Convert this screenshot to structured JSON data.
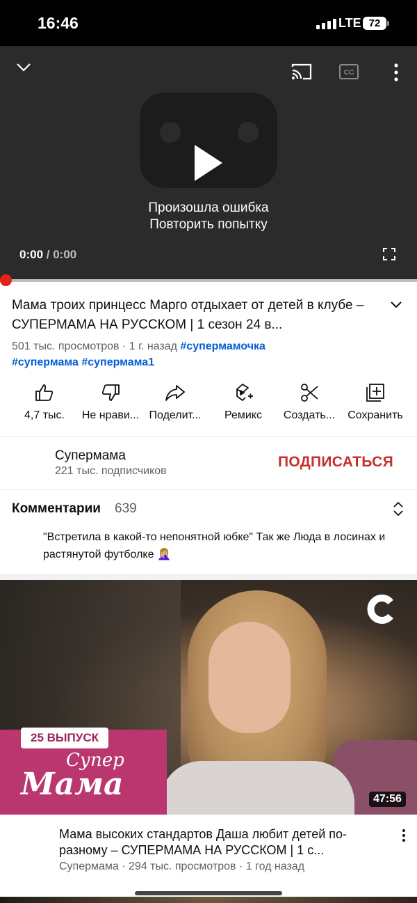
{
  "status_bar": {
    "time": "16:46",
    "network": "LTE",
    "battery": "72"
  },
  "player": {
    "error_line1": "Произошла ошибка",
    "error_line2": "Повторить попытку",
    "current_time": "0:00",
    "separator": " / ",
    "duration": "0:00",
    "progress_fraction": 0
  },
  "video": {
    "title": "Мама троих принцесс Марго отдыхает от детей в клубе – СУПЕРМАМА НА РУССКОМ | 1 сезон 24 в...",
    "views": "501 тыс. просмотров",
    "age": " · 1 г. назад ",
    "tags": [
      "#супермамочка",
      "#супермама",
      "#супермама1"
    ]
  },
  "actions": [
    {
      "label": "4,7 тыс.",
      "icon": "thumb-up-icon"
    },
    {
      "label": "Не нрави...",
      "icon": "thumb-down-icon"
    },
    {
      "label": "Поделит...",
      "icon": "share-icon"
    },
    {
      "label": "Ремикс",
      "icon": "remix-icon"
    },
    {
      "label": "Создать...",
      "icon": "scissors-icon"
    },
    {
      "label": "Сохранить",
      "icon": "save-to-playlist-icon"
    }
  ],
  "channel": {
    "name": "Супермама",
    "subscribers": "221 тыс. подписчиков",
    "subscribe_label": "ПОДПИСАТЬСЯ"
  },
  "comments": {
    "heading": "Комментарии",
    "count": "639",
    "top_comment": "\"Встретила в какой-то непонятной юбке\" Так же Люда в лосинах и растянутой футболке 🤦🏼‍♀️"
  },
  "next_video": {
    "episode_badge": "25 ВЫПУСК",
    "brand_line1": "Супер",
    "brand_line2": "Мама",
    "duration": "47:56",
    "title": "Мама высоких стандартов Даша любит детей по-разному – СУПЕРМАМА НА РУССКОМ | 1 с...",
    "meta": "Супермама · 294 тыс. просмотров · 1 год назад"
  },
  "colors": {
    "subscribe": "#c4302b",
    "hashtag": "#065fd4",
    "progress": "#e62117"
  }
}
